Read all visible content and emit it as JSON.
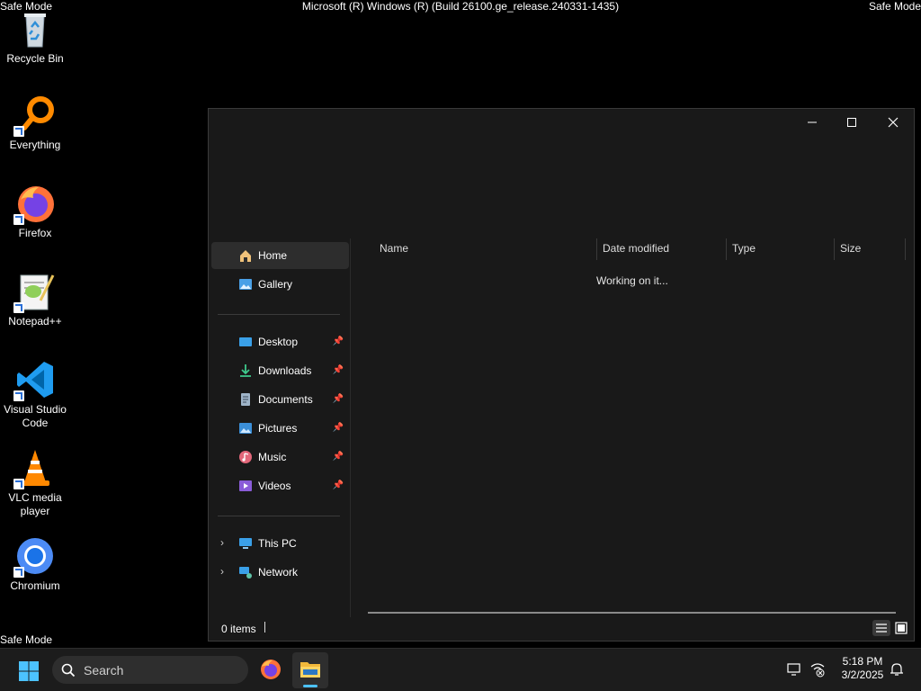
{
  "overlay": {
    "safe_mode": "Safe Mode",
    "build_title": "Microsoft (R) Windows (R) (Build 26100.ge_release.240331-1435)"
  },
  "desktop": {
    "icons": [
      {
        "label": "Recycle Bin"
      },
      {
        "label": "Everything"
      },
      {
        "label": "Firefox"
      },
      {
        "label": "Notepad++"
      },
      {
        "label": "Visual Studio Code"
      },
      {
        "label": "VLC media player"
      },
      {
        "label": "Chromium"
      }
    ]
  },
  "explorer": {
    "controls": {
      "minimize": "—",
      "maximize": "☐",
      "close": "✕"
    },
    "nav": {
      "home": "Home",
      "gallery": "Gallery",
      "desktop": "Desktop",
      "downloads": "Downloads",
      "documents": "Documents",
      "pictures": "Pictures",
      "music": "Music",
      "videos": "Videos",
      "this_pc": "This PC",
      "network": "Network"
    },
    "columns": {
      "name": "Name",
      "date_modified": "Date modified",
      "type": "Type",
      "size": "Size"
    },
    "working": "Working on it...",
    "status": {
      "items": "0 items"
    }
  },
  "taskbar": {
    "search_placeholder": "Search",
    "time": "5:18 PM",
    "date": "3/2/2025"
  },
  "colors": {
    "accent": "#0078d4",
    "window_bg": "#191919",
    "taskbar_bg": "#1c1c1c"
  }
}
